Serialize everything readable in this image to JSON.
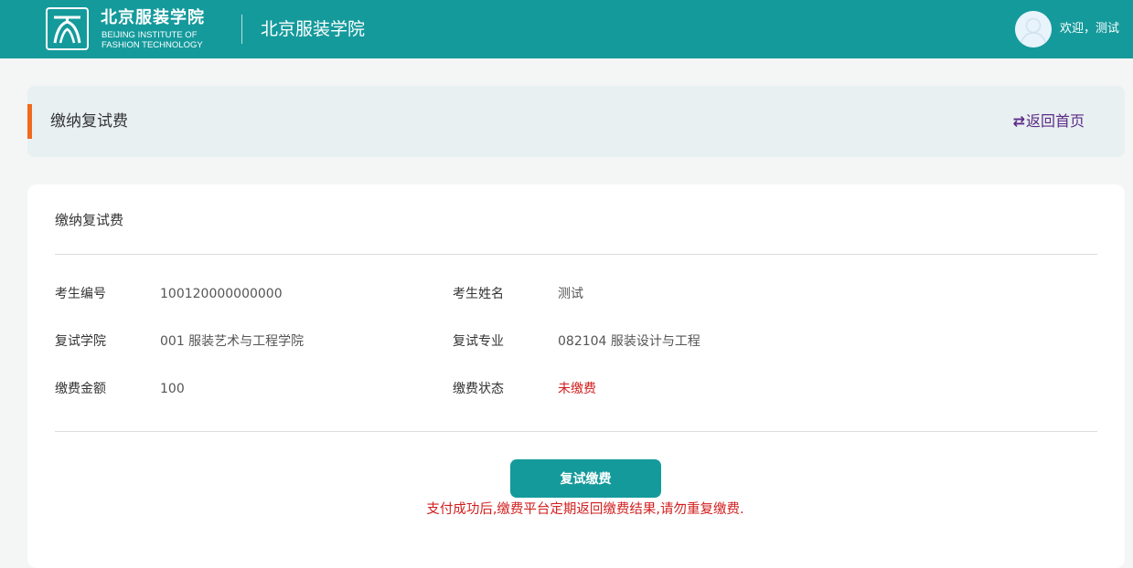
{
  "header": {
    "logo_cn": "北京服装学院",
    "logo_en_line1": "BEIJING INSTITUTE OF",
    "logo_en_line2": "FASHION TECHNOLOGY",
    "title": "北京服装学院",
    "welcome": "欢迎，测试"
  },
  "title_bar": {
    "title": "缴纳复试费",
    "back_link": "返回首页",
    "back_icon": "swap-arrows-icon"
  },
  "card": {
    "title": "缴纳复试费",
    "fields": [
      {
        "label": "考生编号",
        "value": "100120000000000"
      },
      {
        "label": "考生姓名",
        "value": "测试"
      },
      {
        "label": "复试学院",
        "value": "001 服装艺术与工程学院"
      },
      {
        "label": "复试专业",
        "value": "082104 服装设计与工程"
      },
      {
        "label": "缴费金额",
        "value": "100"
      },
      {
        "label": "缴费状态",
        "value": "未缴费"
      }
    ],
    "pay_button": "复试缴费",
    "notice": "支付成功后,缴费平台定期返回缴费结果,请勿重复缴费."
  },
  "colors": {
    "header_bg": "#159a9c",
    "accent_orange": "#f06a1f",
    "link_purple": "#5b2a86",
    "alert_red": "#d21e1e"
  }
}
